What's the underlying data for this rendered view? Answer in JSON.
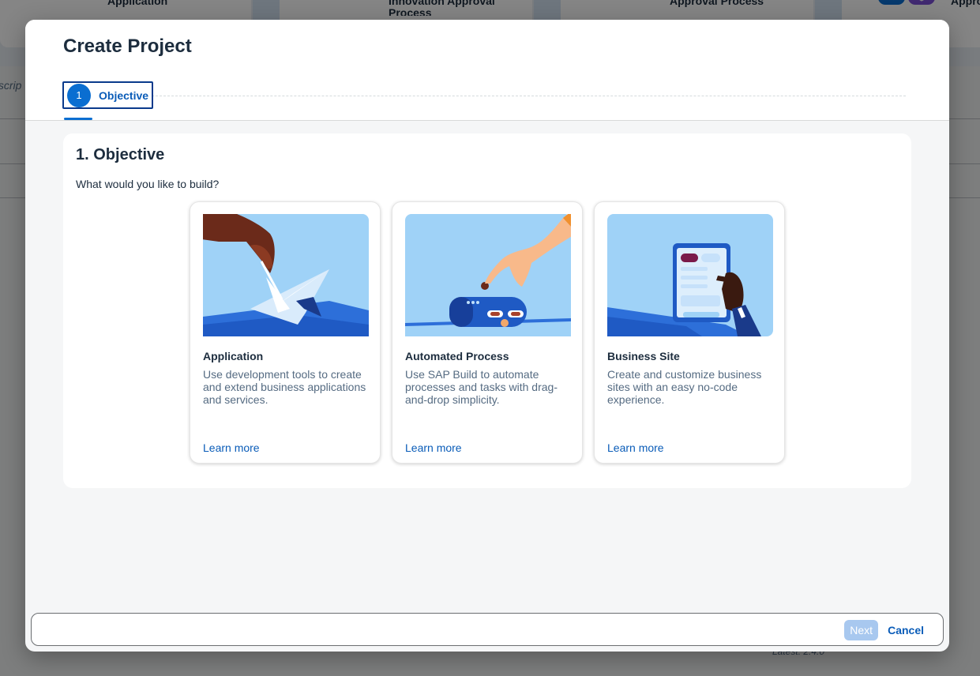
{
  "background": {
    "cards": [
      {
        "label": "Application"
      },
      {
        "label": "Innovation Approval Process"
      },
      {
        "label": "Approval Process"
      },
      {
        "label": "Appro"
      }
    ],
    "search_placeholder": "Descrip",
    "latest_label": "Latest: 2.4.0"
  },
  "dialog": {
    "title": "Create Project",
    "steps": [
      {
        "number": "1",
        "label": "Objective"
      }
    ],
    "section": {
      "title": "1. Objective",
      "question": "What would you like to build?"
    },
    "cards": [
      {
        "title": "Application",
        "description": "Use development tools to create and extend business applications and services.",
        "link": "Learn more",
        "icon": "origami-crane-illustration"
      },
      {
        "title": "Automated Process",
        "description": "Use SAP Build to automate processes and tasks with drag-and-drop simplicity.",
        "link": "Learn more",
        "icon": "robot-hand-illustration"
      },
      {
        "title": "Business Site",
        "description": "Create and customize business sites with an easy no-code experience.",
        "link": "Learn more",
        "icon": "tablet-hand-illustration"
      }
    ],
    "footer": {
      "next_label": "Next",
      "cancel_label": "Cancel"
    }
  },
  "colors": {
    "accent": "#0a6ed1",
    "link": "#0a5cb8",
    "illustration_bg": "#9fd2f7",
    "next_disabled": "#a8c8ef"
  }
}
